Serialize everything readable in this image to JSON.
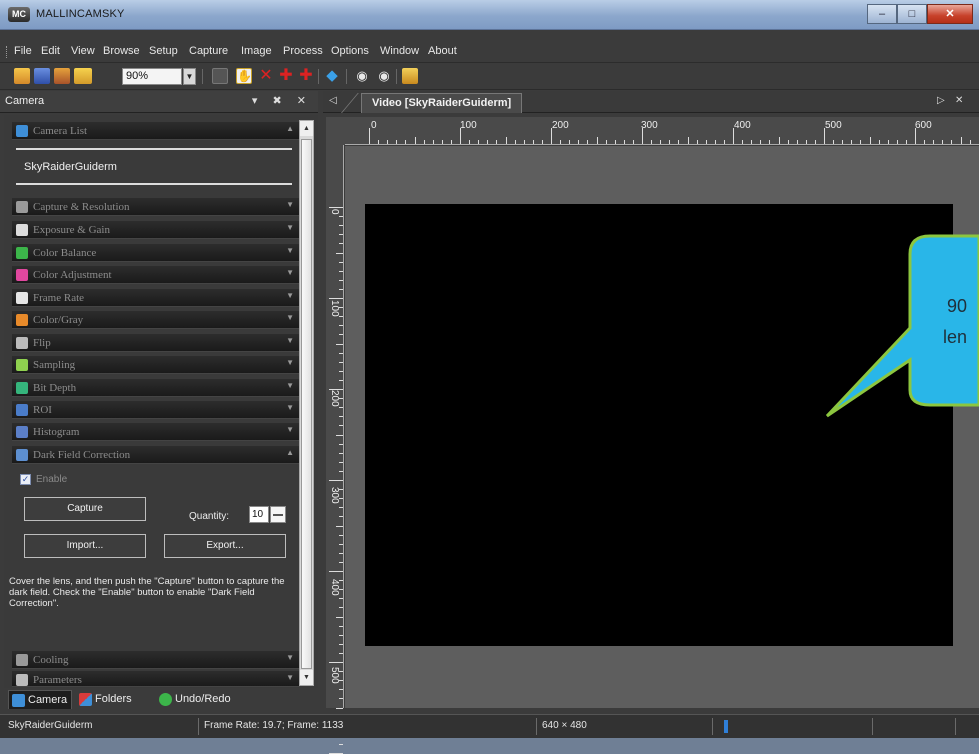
{
  "window": {
    "title": "MALLINCAMSKY",
    "logo_text": "MC",
    "controls": {
      "minimize": "–",
      "maximize": "□",
      "close": "✕"
    }
  },
  "menu": [
    "File",
    "Edit",
    "View",
    "Browse",
    "Setup",
    "Capture",
    "Image",
    "Process",
    "Options",
    "Window",
    "About"
  ],
  "toolbar": {
    "zoom_value": "90%",
    "icons": [
      "open-folder-icon",
      "save-icon",
      "edit-icon",
      "folder-icon",
      "hand-tool-icon",
      "delete-icon",
      "crosshair-icon",
      "crosshair-alt-icon",
      "target-icon",
      "record-icon",
      "stop-icon",
      "snapshot-icon"
    ]
  },
  "left_panel": {
    "title": "Camera",
    "header_buttons": "▾ ✖ ✕",
    "camera_list": {
      "label": "Camera List",
      "cameras": [
        "SkyRaiderGuiderm"
      ]
    },
    "categories": [
      {
        "label": "Capture & Resolution",
        "icon": "camera-icon",
        "color": "#9a9a9a"
      },
      {
        "label": "Exposure & Gain",
        "icon": "exposure-icon",
        "color": "#dddddd"
      },
      {
        "label": "Color Balance",
        "icon": "color-balance-icon",
        "color": "#3cb54a"
      },
      {
        "label": "Color Adjustment",
        "icon": "color-wheel-icon",
        "color": "#e0479e"
      },
      {
        "label": "Frame Rate",
        "icon": "clock-icon",
        "color": "#e6e6e6"
      },
      {
        "label": "Color/Gray",
        "icon": "color-gray-icon",
        "color": "#e88a2a"
      },
      {
        "label": "Flip",
        "icon": "flip-icon",
        "color": "#bbbbbb"
      },
      {
        "label": "Sampling",
        "icon": "pencil-icon",
        "color": "#8fd14f"
      },
      {
        "label": "Bit Depth",
        "icon": "bit-depth-icon",
        "color": "#35b57c"
      },
      {
        "label": "ROI",
        "icon": "roi-icon",
        "color": "#4a7cc9"
      },
      {
        "label": "Histogram",
        "icon": "histogram-icon",
        "color": "#5b7fc8"
      },
      {
        "label": "Dark Field Correction",
        "icon": "dark-field-icon",
        "color": "#5d8fd0"
      }
    ],
    "dark_field": {
      "enable_label": "Enable",
      "enable_checked": true,
      "capture_button": "Capture",
      "quantity_label": "Quantity:",
      "quantity_value": "10",
      "import_button": "Import...",
      "export_button": "Export...",
      "help_text": "Cover the lens, and then push the \"Capture\" button to capture the dark field. Check the \"Enable\" button to enable \"Dark Field Correction\"."
    },
    "lower_categories": [
      {
        "label": "Cooling",
        "icon": "cooling-icon",
        "color": "#999999"
      },
      {
        "label": "Parameters",
        "icon": "parameters-icon",
        "color": "#bbbbbb"
      }
    ],
    "bottom_tabs": [
      {
        "label": "Camera",
        "icon": "camera-tab-icon",
        "color": "#3e8fd8"
      },
      {
        "label": "Folders",
        "icon": "folders-icon",
        "color": "#d83b3b"
      },
      {
        "label": "Undo/Redo",
        "icon": "undo-redo-icon",
        "color": "#3cb54a"
      }
    ]
  },
  "document": {
    "tab_label": "Video [SkyRaiderGuiderm]",
    "nav_left": "◁",
    "nav_right": "▷",
    "close": "✕",
    "ruler_h_labels": [
      "0",
      "100",
      "200",
      "300",
      "400",
      "500",
      "600"
    ],
    "ruler_v_labels": [
      "0",
      "100",
      "200",
      "300",
      "400",
      "500"
    ]
  },
  "callout": {
    "text_line1": "90",
    "text_line2": "len",
    "fill": "#29b6e8",
    "border": "#8cc63f"
  },
  "status_bar": {
    "camera": "SkyRaiderGuiderm",
    "frame_info": "Frame Rate: 19.7; Frame: 1133",
    "resolution": "640 × 480"
  }
}
